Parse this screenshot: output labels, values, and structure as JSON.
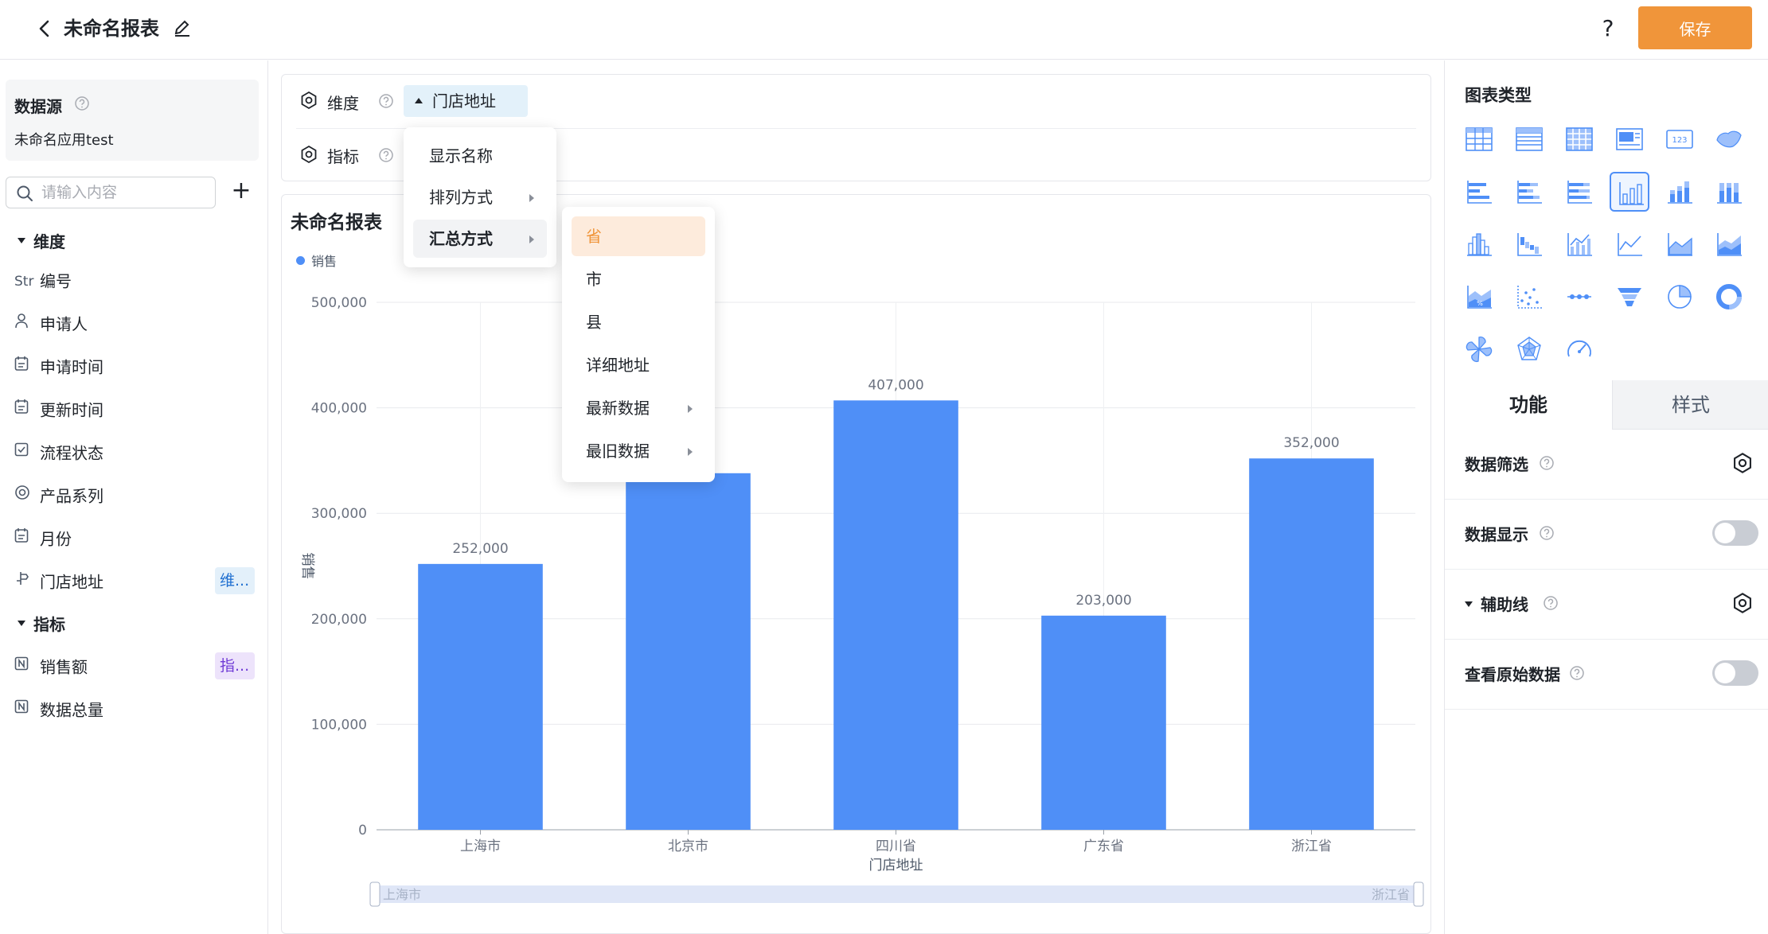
{
  "header": {
    "title": "未命名报表",
    "help_label": "?",
    "save_label": "保存"
  },
  "left_panel": {
    "datasource_title": "数据源",
    "datasource_name": "未命名应用test",
    "search_placeholder": "请输入内容",
    "add_label": "+",
    "dimension_group": "维度",
    "metric_group": "指标",
    "dimension_fields": [
      {
        "icon": "Str",
        "label": "编号"
      },
      {
        "icon": "user-icon",
        "label": "申请人"
      },
      {
        "icon": "calendar-icon",
        "label": "申请时间"
      },
      {
        "icon": "calendar-icon",
        "label": "更新时间"
      },
      {
        "icon": "checkbox-icon",
        "label": "流程状态"
      },
      {
        "icon": "target-icon",
        "label": "产品系列"
      },
      {
        "icon": "calendar-icon",
        "label": "月份"
      },
      {
        "icon": "location-icon",
        "label": "门店地址",
        "tag": "维..."
      }
    ],
    "metric_fields": [
      {
        "icon": "number-icon",
        "label": "销售额",
        "tag": "指..."
      },
      {
        "icon": "number-icon",
        "label": "数据总量"
      }
    ]
  },
  "config": {
    "dimension_label": "维度",
    "metric_label": "指标",
    "dimension_chip": "门店地址"
  },
  "menu_level1": [
    {
      "label": "显示名称"
    },
    {
      "label": "排列方式"
    },
    {
      "label": "汇总方式"
    }
  ],
  "menu_level2": [
    {
      "label": "省"
    },
    {
      "label": "市"
    },
    {
      "label": "县"
    },
    {
      "label": "详细地址"
    },
    {
      "label": "最新数据"
    },
    {
      "label": "最旧数据"
    }
  ],
  "chart_title": "未命名报表",
  "chart_data": {
    "type": "bar",
    "title": "未命名报表",
    "categories": [
      "上海市",
      "北京市",
      "四川省",
      "广东省",
      "浙江省"
    ],
    "series": [
      {
        "name": "销售",
        "values": [
          252000,
          338000,
          407000,
          203000,
          352000
        ]
      }
    ],
    "data_labels": [
      "252,000",
      "",
      "407,000",
      "203,000",
      "352,000"
    ],
    "xlabel": "门店地址",
    "ylabel": "销售",
    "ylim": [
      0,
      500000
    ],
    "yticks": [
      0,
      100000,
      200000,
      300000,
      400000,
      500000
    ],
    "ytick_labels": [
      "0",
      "100,000",
      "200,000",
      "300,000",
      "400,000",
      "500,000"
    ],
    "grid": true,
    "legend": "top-left",
    "bar_color": "#4f8ff7",
    "slider_start": "上海市",
    "slider_end": "浙江省"
  },
  "right_panel": {
    "chart_type_title": "图表类型",
    "tabs": [
      "功能",
      "样式"
    ],
    "props": [
      {
        "label": "数据筛选",
        "control": "gear"
      },
      {
        "label": "数据显示",
        "control": "toggle"
      },
      {
        "label": "辅助线",
        "control": "gear"
      },
      {
        "label": "查看原始数据",
        "control": "toggle"
      }
    ]
  },
  "colors": {
    "accent": "#f0953a",
    "bar": "#4f8ff7",
    "selected_icon_border": "#4f8ff7"
  }
}
